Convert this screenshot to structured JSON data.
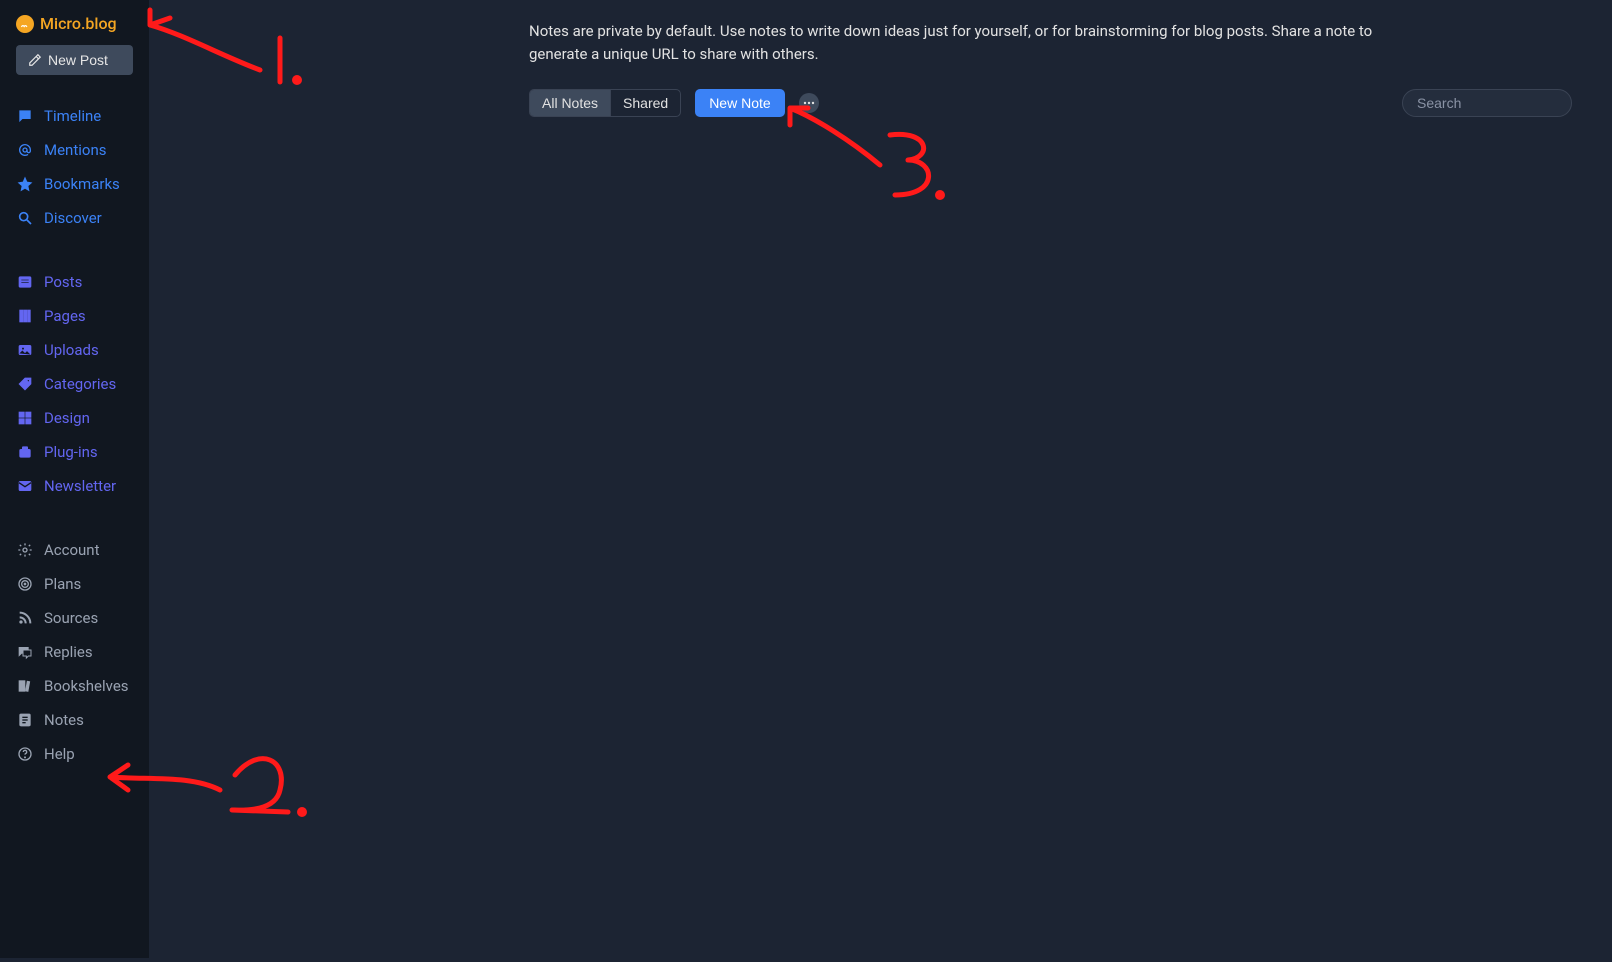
{
  "brand": {
    "name": "Micro.blog"
  },
  "newPost": {
    "label": "New Post"
  },
  "nav": {
    "group1": [
      {
        "label": "Timeline",
        "icon": "message"
      },
      {
        "label": "Mentions",
        "icon": "at"
      },
      {
        "label": "Bookmarks",
        "icon": "star"
      },
      {
        "label": "Discover",
        "icon": "search"
      }
    ],
    "group2": [
      {
        "label": "Posts",
        "icon": "posts"
      },
      {
        "label": "Pages",
        "icon": "pages"
      },
      {
        "label": "Uploads",
        "icon": "uploads"
      },
      {
        "label": "Categories",
        "icon": "tag"
      },
      {
        "label": "Design",
        "icon": "design"
      },
      {
        "label": "Plug-ins",
        "icon": "plugin"
      },
      {
        "label": "Newsletter",
        "icon": "mail"
      }
    ],
    "group3": [
      {
        "label": "Account",
        "icon": "gear"
      },
      {
        "label": "Plans",
        "icon": "target"
      },
      {
        "label": "Sources",
        "icon": "rss"
      },
      {
        "label": "Replies",
        "icon": "replies"
      },
      {
        "label": "Bookshelves",
        "icon": "books"
      },
      {
        "label": "Notes",
        "icon": "notes"
      },
      {
        "label": "Help",
        "icon": "help"
      }
    ]
  },
  "main": {
    "intro": "Notes are private by default. Use notes to write down ideas just for yourself, or for brainstorming for blog posts. Share a note to generate a unique URL to share with others.",
    "tabs": {
      "all": "All Notes",
      "shared": "Shared"
    },
    "newNote": "New Note",
    "searchPlaceholder": "Search"
  },
  "annotations": {
    "n1": "1.",
    "n2": "2.",
    "n3": "3."
  }
}
